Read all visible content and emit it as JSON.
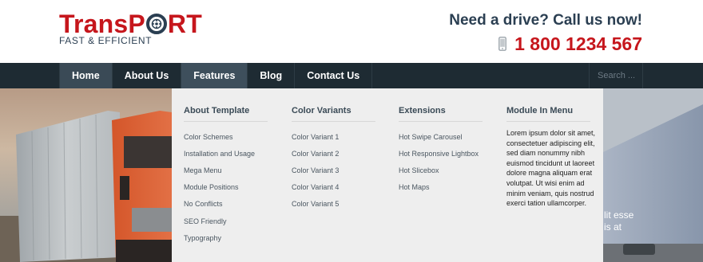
{
  "logo": {
    "title_prefix": "TransP",
    "title_suffix": "RT",
    "subtitle": "FAST & EFFICIENT"
  },
  "cta": {
    "text": "Need a drive? Call us now!",
    "phone": "1 800 1234 567"
  },
  "nav": {
    "items": [
      "Home",
      "About Us",
      "Features",
      "Blog",
      "Contact Us"
    ],
    "search_placeholder": "Search ..."
  },
  "mega_menu": {
    "columns": [
      {
        "title": "About Template",
        "links": [
          "Color Schemes",
          "Installation and Usage",
          "Mega Menu",
          "Module Positions",
          "No Conflicts",
          "SEO Friendly",
          "Typography"
        ]
      },
      {
        "title": "Color Variants",
        "links": [
          "Color Variant 1",
          "Color Variant 2",
          "Color Variant 3",
          "Color Variant 4",
          "Color Variant 5"
        ]
      },
      {
        "title": "Extensions",
        "links": [
          "Hot Swipe Carousel",
          "Hot Responsive Lightbox",
          "Hot Slicebox",
          "Hot Maps"
        ]
      },
      {
        "title": "Module In Menu",
        "text": "Lorem ipsum dolor sit amet, consectetuer adipiscing elit, sed diam nonummy nibh euismod tincidunt ut laoreet dolore magna aliquam erat volutpat. Ut wisi enim ad minim veniam, quis nostrud exerci tation ullamcorper."
      }
    ]
  },
  "hero": {
    "caption_line1": "lit esse",
    "caption_line2": "is at"
  },
  "colors": {
    "brand_red": "#c6161c",
    "navy": "#2b3f52",
    "nav_bg": "#1e2b33"
  }
}
